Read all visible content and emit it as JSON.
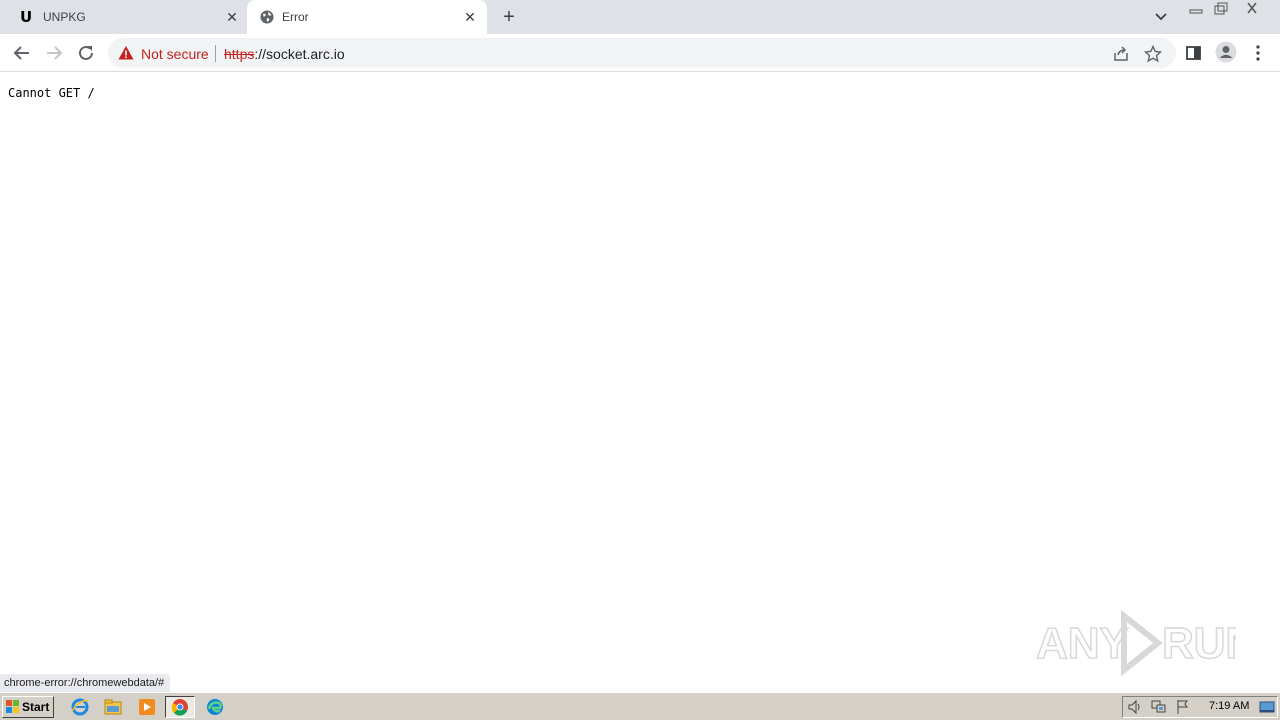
{
  "tabs": [
    {
      "title": "UNPKG",
      "favicon": "U",
      "active": false
    },
    {
      "title": "Error",
      "favicon": "globe-icon",
      "active": true
    }
  ],
  "omnibox": {
    "security_label": "Not secure",
    "scheme": "https",
    "url_rest": "://socket.arc.io"
  },
  "page": {
    "message": "Cannot GET /"
  },
  "status_bar": {
    "url": "chrome-error://chromewebdata/#"
  },
  "watermark": {
    "text": "ANY RUN"
  },
  "taskbar": {
    "start_label": "Start",
    "apps": [
      "internet-explorer-icon",
      "file-explorer-icon",
      "media-player-icon",
      "chrome-icon",
      "edge-icon"
    ],
    "clock": "7:19 AM"
  },
  "colors": {
    "tab_strip": "#dee1e6",
    "omnibox_bg": "#f1f3f4",
    "not_secure": "#c5221f",
    "taskbar": "#d4d0c8"
  }
}
